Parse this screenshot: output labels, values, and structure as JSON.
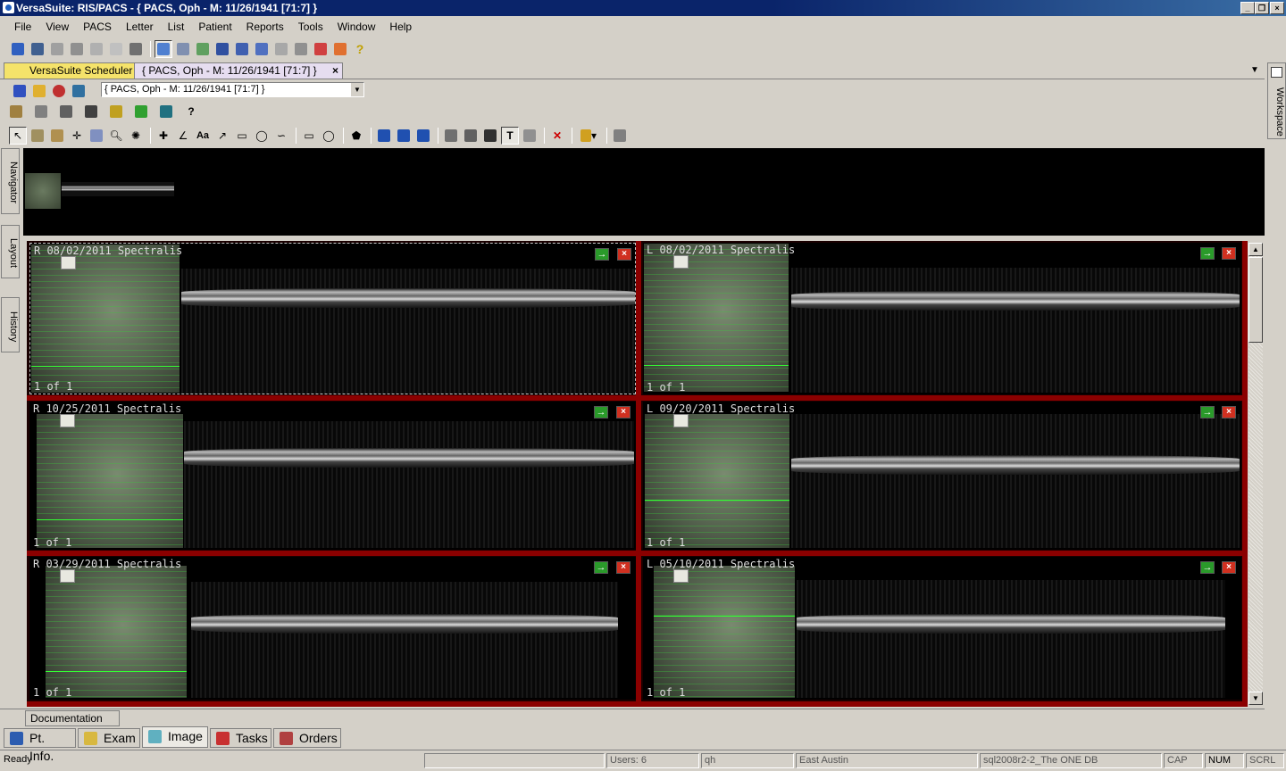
{
  "window": {
    "title": "VersaSuite: RIS/PACS - { PACS, Oph  - M: 11/26/1941 [71:7] }"
  },
  "menu": [
    "File",
    "View",
    "PACS",
    "Letter",
    "List",
    "Patient",
    "Reports",
    "Tools",
    "Window",
    "Help"
  ],
  "tabs": {
    "scheduler": "VersaSuite Scheduler",
    "patient": "{ PACS, Oph  - M: 11/26/1941 [71:7] }",
    "close": "×"
  },
  "patient_select": {
    "value": "{ PACS, Oph  - M: 11/26/1941 [71:7] }"
  },
  "side_tabs": {
    "navigator": "Navigator",
    "layout": "Layout",
    "history": "History",
    "workspace": "Workspace"
  },
  "panes": [
    {
      "label": "R  08/02/2011 Spectralis",
      "count": "1 of 1"
    },
    {
      "label": "L  08/02/2011 Spectralis",
      "count": "1 of 1"
    },
    {
      "label": "R  10/25/2011 Spectralis",
      "count": "1 of 1"
    },
    {
      "label": "L  09/20/2011 Spectralis",
      "count": "1 of 1"
    },
    {
      "label": "R  03/29/2011 Spectralis",
      "count": "1 of 1"
    },
    {
      "label": "L  05/10/2011 Spectralis",
      "count": "1 of 1"
    }
  ],
  "pane_icons": {
    "go": "→",
    "close": "×"
  },
  "documentation_label": "Documentation",
  "bottom_tabs": [
    "Pt. Info.",
    "Exam",
    "Image",
    "Tasks",
    "Orders"
  ],
  "status": {
    "ready": "Ready",
    "users": "Users: 6",
    "user": "qh",
    "location": "East Austin",
    "db": "sql2008r2-2_The ONE DB",
    "cap": "CAP",
    "num": "NUM",
    "scrl": "SCRL"
  },
  "colors": {
    "titlebar": "#0a246a",
    "grid_border": "#8b0000",
    "ui": "#d4d0c8"
  },
  "icons": {
    "toolbar": [
      "patient-icon",
      "schedule-icon",
      "grid-icon",
      "report-icon",
      "print-icon",
      "lock-icon",
      "pacs-icon",
      "help-icon"
    ],
    "pane": [
      "report-icon",
      "arrow-right-icon",
      "close-icon"
    ]
  }
}
